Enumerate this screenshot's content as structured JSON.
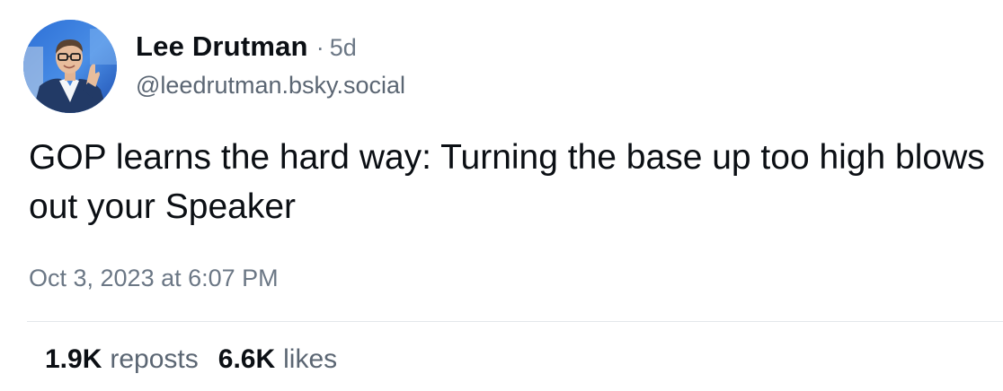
{
  "post": {
    "author": {
      "display_name": "Lee Drutman",
      "handle": "@leedrutman.bsky.social",
      "avatar_icon": "user-avatar-photo"
    },
    "separator": "·",
    "age": "5d",
    "text": "GOP learns the hard way: Turning the base up too high blows out your Speaker",
    "timestamp": "Oct 3, 2023 at 6:07 PM",
    "stats": {
      "reposts_count": "1.9K",
      "reposts_label": "reposts",
      "likes_count": "6.6K",
      "likes_label": "likes"
    }
  },
  "colors": {
    "text_primary": "#0b0f14",
    "text_secondary": "#6b7785",
    "divider": "#e3e7eb",
    "avatar_background": "#3f7fd8"
  }
}
